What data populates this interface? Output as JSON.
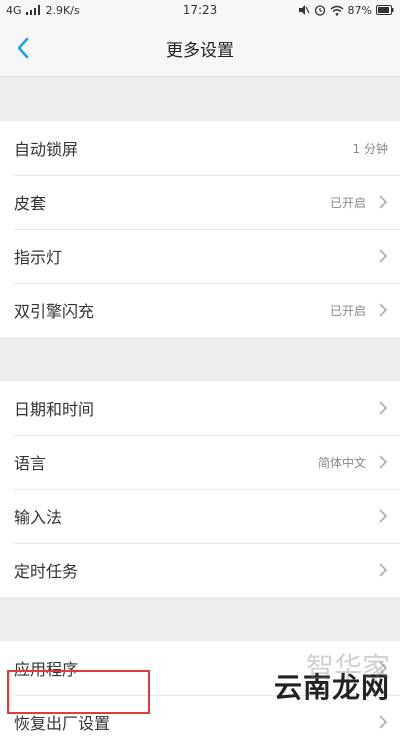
{
  "status_bar": {
    "network": "4G",
    "speed": "2.9K/s",
    "time": "17:23",
    "battery": "87%"
  },
  "nav": {
    "title": "更多设置"
  },
  "groups": [
    {
      "items": [
        {
          "label": "自动锁屏",
          "value": "1 分钟",
          "chevron": false
        },
        {
          "label": "皮套",
          "value": "已开启",
          "chevron": true
        },
        {
          "label": "指示灯",
          "value": "",
          "chevron": true
        },
        {
          "label": "双引擎闪充",
          "value": "已开启",
          "chevron": true
        }
      ]
    },
    {
      "items": [
        {
          "label": "日期和时间",
          "value": "",
          "chevron": true
        },
        {
          "label": "语言",
          "value": "简体中文",
          "chevron": true
        },
        {
          "label": "输入法",
          "value": "",
          "chevron": true
        },
        {
          "label": "定时任务",
          "value": "",
          "chevron": true
        }
      ]
    },
    {
      "items": [
        {
          "label": "应用程序",
          "value": "",
          "chevron": true
        },
        {
          "label": "恢复出厂设置",
          "value": "",
          "chevron": true
        }
      ]
    }
  ],
  "watermark": {
    "text": "云南龙网",
    "faint": "智华家"
  },
  "colors": {
    "accent": "#1aa3e8",
    "highlight": "#e33a3a"
  }
}
